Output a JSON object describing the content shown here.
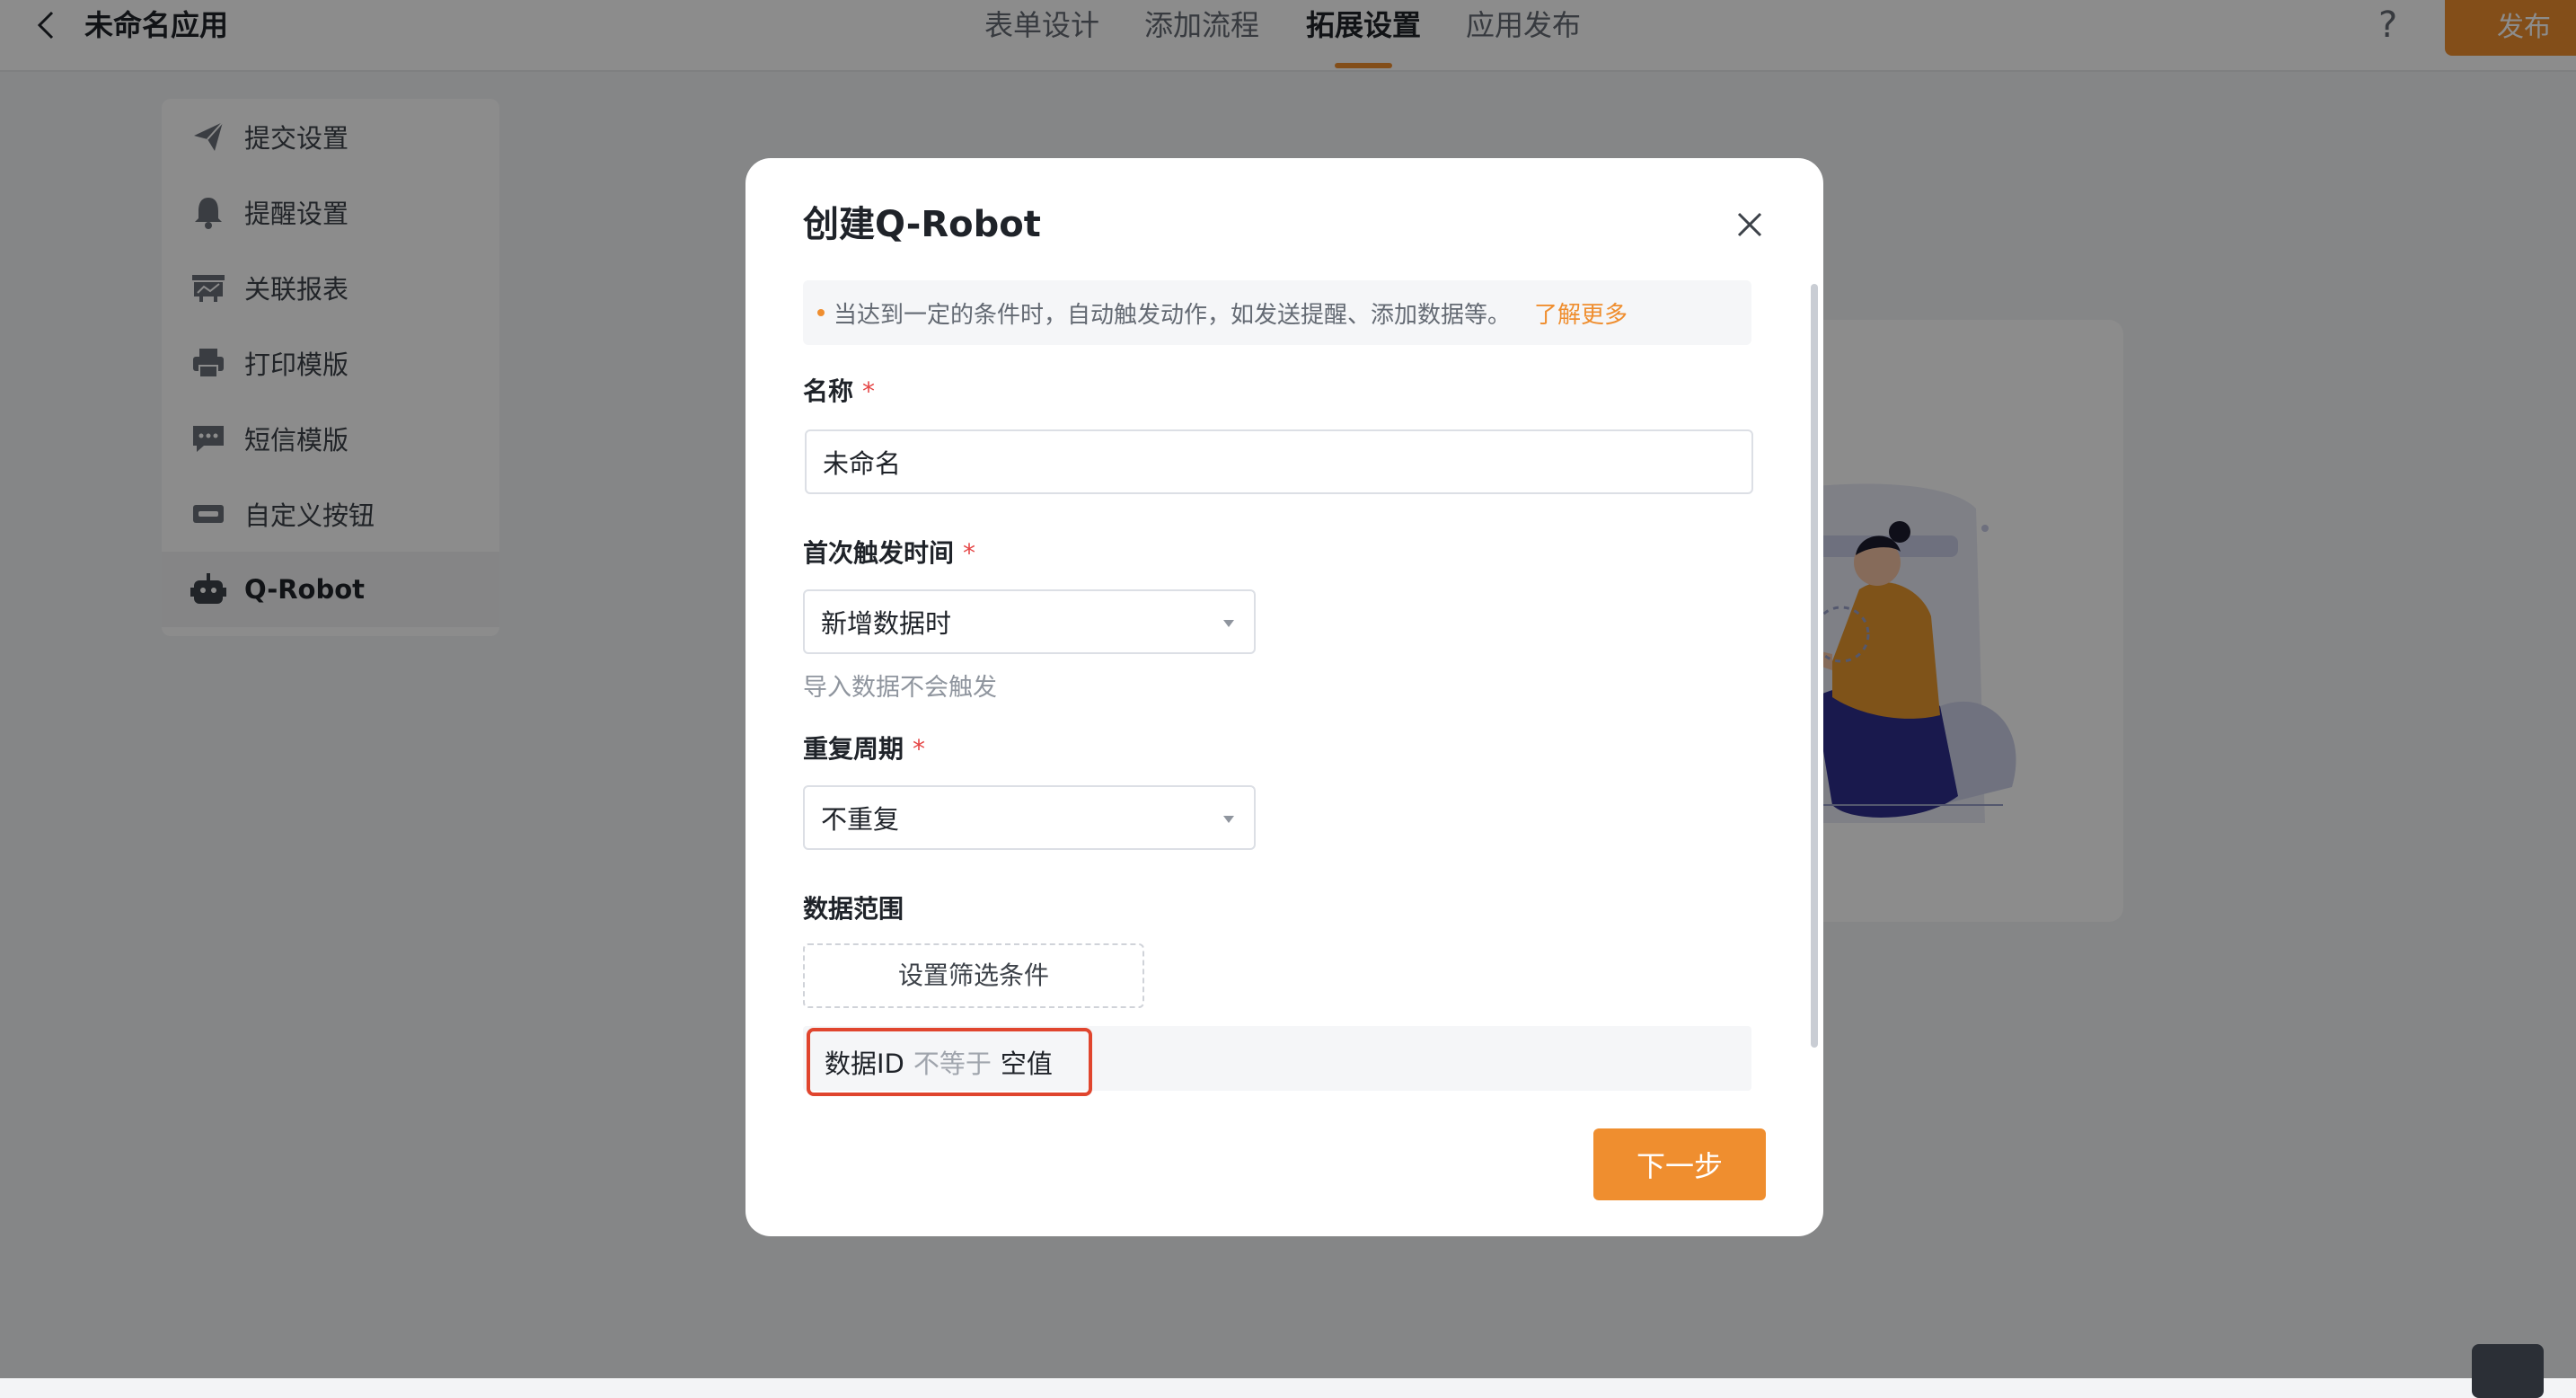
{
  "app": {
    "title": "未命名应用"
  },
  "header": {
    "tabs": [
      {
        "label": "表单设计",
        "active": false
      },
      {
        "label": "添加流程",
        "active": false
      },
      {
        "label": "拓展设置",
        "active": true
      },
      {
        "label": "应用发布",
        "active": false
      }
    ],
    "help": "?",
    "publish_label": "发布"
  },
  "sidebar": {
    "items": [
      {
        "label": "提交设置",
        "icon": "paper-plane-icon"
      },
      {
        "label": "提醒设置",
        "icon": "bell-icon"
      },
      {
        "label": "关联报表",
        "icon": "report-icon"
      },
      {
        "label": "打印模版",
        "icon": "printer-icon"
      },
      {
        "label": "短信模版",
        "icon": "message-icon"
      },
      {
        "label": "自定义按钮",
        "icon": "button-icon"
      },
      {
        "label": "Q-Robot",
        "icon": "robot-icon",
        "active": true
      }
    ]
  },
  "modal": {
    "title": "创建Q-Robot",
    "notice": "当达到一定的条件时，自动触发动作，如发送提醒、添加数据等。",
    "learn_more": "了解更多",
    "name_label": "名称",
    "name_value": "未命名",
    "trigger_label": "首次触发时间",
    "trigger_value": "新增数据时",
    "trigger_hint": "导入数据不会触发",
    "repeat_label": "重复周期",
    "repeat_value": "不重复",
    "range_label": "数据范围",
    "filter_button": "设置筛选条件",
    "condition": {
      "field": "数据ID",
      "operator": "不等于",
      "value": "空值"
    },
    "next_button": "下一步",
    "required_mark": "*"
  },
  "colors": {
    "accent": "#ef8e2f",
    "required": "#e54545",
    "highlight": "#e0452e"
  }
}
